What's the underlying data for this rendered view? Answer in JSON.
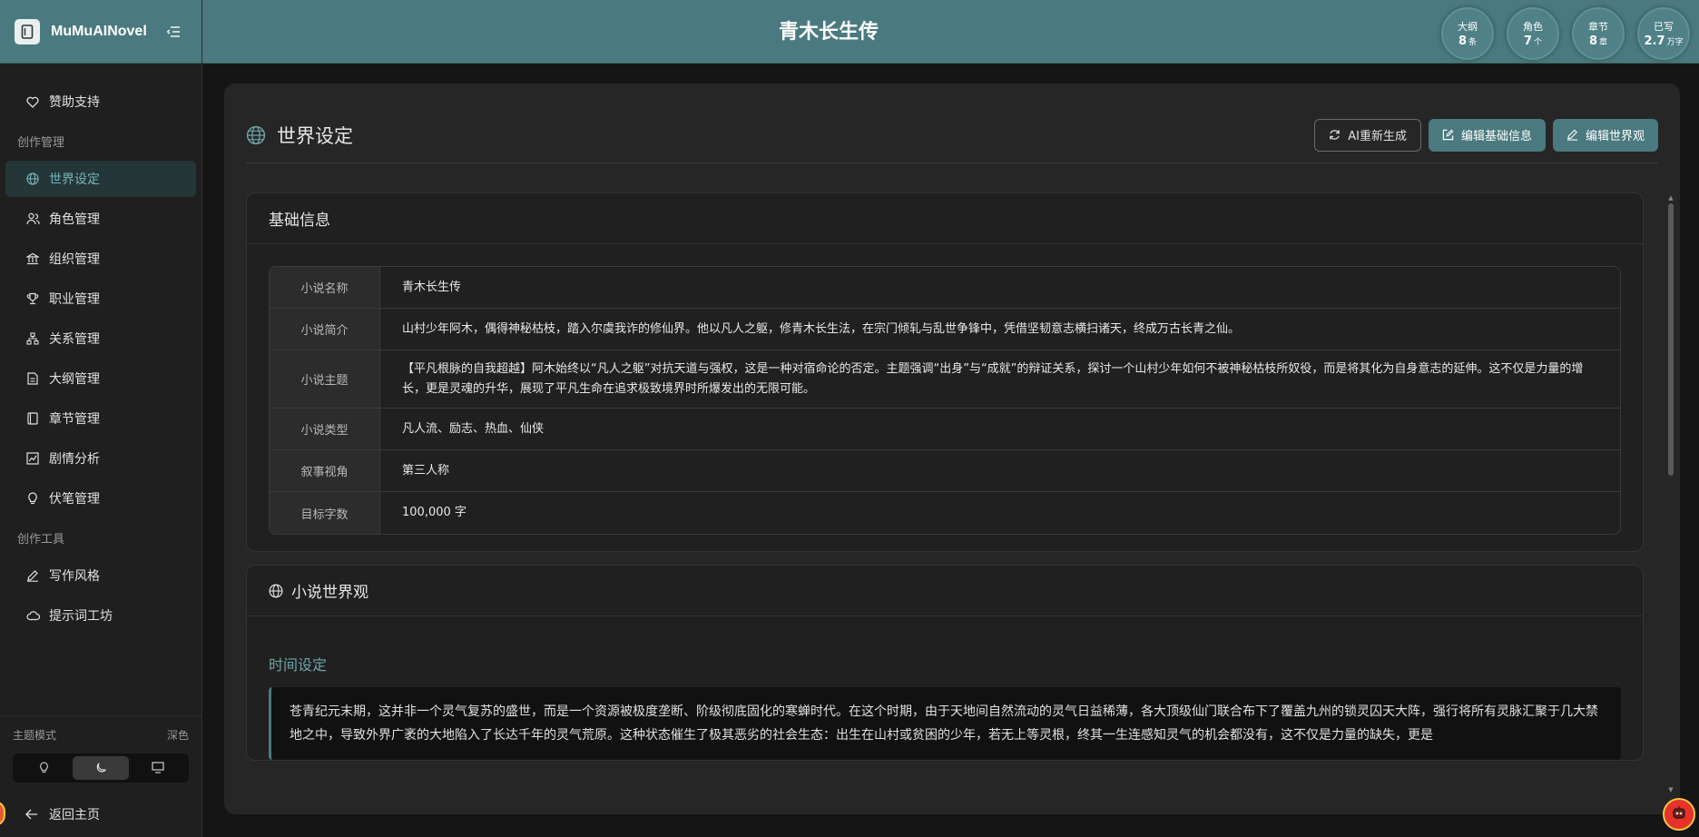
{
  "brand": {
    "name": "MuMuAINovel"
  },
  "header": {
    "title": "青木长生传",
    "stats": [
      {
        "label": "大纲",
        "value": "8",
        "unit": "条"
      },
      {
        "label": "角色",
        "value": "7",
        "unit": "个"
      },
      {
        "label": "章节",
        "value": "8",
        "unit": "章"
      },
      {
        "label": "已写",
        "value": "2.7",
        "unit": "万字"
      }
    ]
  },
  "sidebar": {
    "sponsor": "赞助支持",
    "group_create": "创作管理",
    "items": [
      {
        "label": "世界设定",
        "icon": "globe-icon"
      },
      {
        "label": "角色管理",
        "icon": "users-icon"
      },
      {
        "label": "组织管理",
        "icon": "bank-icon"
      },
      {
        "label": "职业管理",
        "icon": "trophy-icon"
      },
      {
        "label": "关系管理",
        "icon": "tree-icon"
      },
      {
        "label": "大纲管理",
        "icon": "file-icon"
      },
      {
        "label": "章节管理",
        "icon": "book-icon"
      },
      {
        "label": "剧情分析",
        "icon": "chart-icon"
      },
      {
        "label": "伏笔管理",
        "icon": "bulb-icon"
      }
    ],
    "group_tools": "创作工具",
    "tools": [
      {
        "label": "写作风格",
        "icon": "pen-icon"
      },
      {
        "label": "提示词工坊",
        "icon": "cloud-icon"
      }
    ],
    "theme": {
      "label": "主题模式",
      "current": "深色"
    },
    "back_home": "返回主页"
  },
  "panel": {
    "title": "世界设定",
    "actions": {
      "regen": "AI重新生成",
      "edit_basic": "编辑基础信息",
      "edit_world": "编辑世界观"
    }
  },
  "basic_info": {
    "title": "基础信息",
    "rows": [
      {
        "key": "小说名称",
        "value": "青木长生传"
      },
      {
        "key": "小说简介",
        "value": "山村少年阿木，偶得神秘枯枝，踏入尔虞我诈的修仙界。他以凡人之躯，修青木长生法，在宗门倾轧与乱世争锋中，凭借坚韧意志横扫诸天，终成万古长青之仙。"
      },
      {
        "key": "小说主题",
        "value": "【平凡根脉的自我超越】阿木始终以“凡人之躯”对抗天道与强权，这是一种对宿命论的否定。主题强调“出身”与“成就”的辩证关系，探讨一个山村少年如何不被神秘枯枝所奴役，而是将其化为自身意志的延伸。这不仅是力量的增长，更是灵魂的升华，展现了平凡生命在追求极致境界时所爆发出的无限可能。"
      },
      {
        "key": "小说类型",
        "value": "凡人流、励志、热血、仙侠"
      },
      {
        "key": "叙事视角",
        "value": "第三人称"
      },
      {
        "key": "目标字数",
        "value": "100,000 字"
      }
    ]
  },
  "world": {
    "title": "小说世界观",
    "time_title": "时间设定",
    "time_text": "苍青纪元末期，这并非一个灵气复苏的盛世，而是一个资源被极度垄断、阶级彻底固化的寒蝉时代。在这个时期，由于天地间自然流动的灵气日益稀薄，各大顶级仙门联合布下了覆盖九州的锁灵囚天大阵，强行将所有灵脉汇聚于几大禁地之中，导致外界广袤的大地陷入了长达千年的灵气荒原。这种状态催生了极其恶劣的社会生态：出生在山村或贫困的少年，若无上等灵根，终其一生连感知灵气的机会都没有，这不仅是力量的缺失，更是"
  },
  "colors": {
    "accent": "#4a7a7f",
    "accent_text": "#6fa5aa"
  }
}
